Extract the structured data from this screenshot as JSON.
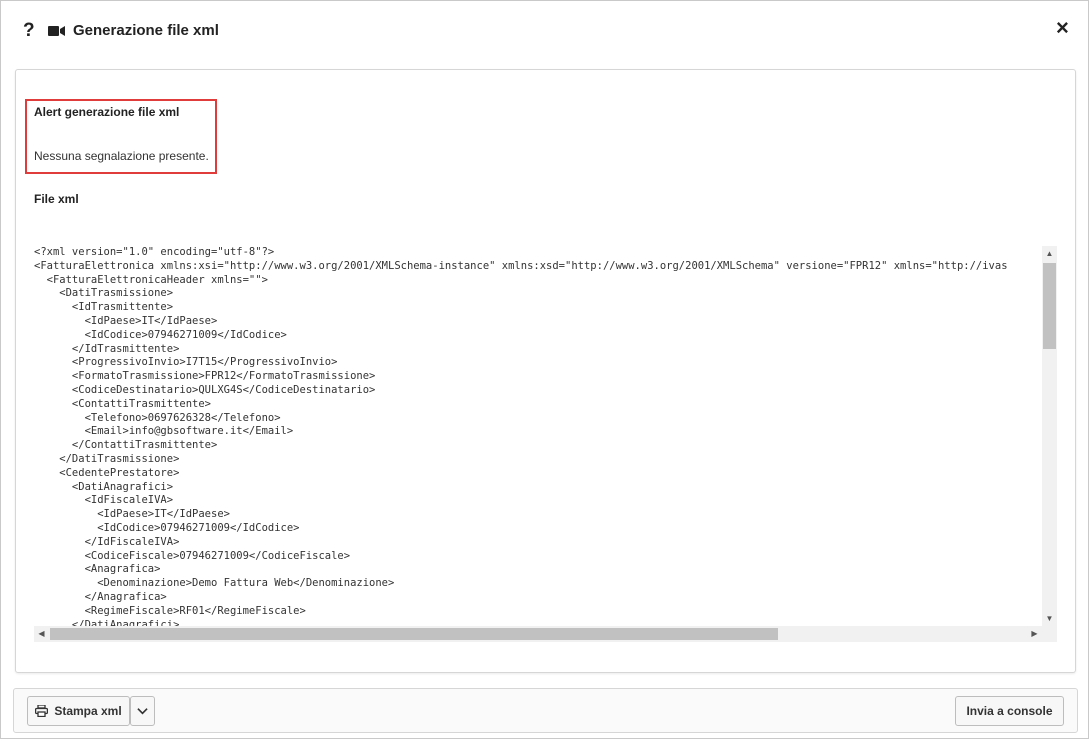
{
  "dialog": {
    "title": "Generazione file xml",
    "help_icon_glyph": "?",
    "close_icon_glyph": "×"
  },
  "alert": {
    "title": "Alert generazione file xml",
    "message": "Nessuna segnalazione presente.",
    "border_color": "#e03c3c"
  },
  "file": {
    "label": "File xml",
    "lines": [
      "<?xml version=\"1.0\" encoding=\"utf-8\"?>",
      "<FatturaElettronica xmlns:xsi=\"http://www.w3.org/2001/XMLSchema-instance\" xmlns:xsd=\"http://www.w3.org/2001/XMLSchema\" versione=\"FPR12\" xmlns=\"http://ivas",
      "  <FatturaElettronicaHeader xmlns=\"\">",
      "    <DatiTrasmissione>",
      "      <IdTrasmittente>",
      "        <IdPaese>IT</IdPaese>",
      "        <IdCodice>07946271009</IdCodice>",
      "      </IdTrasmittente>",
      "      <ProgressivoInvio>I7T15</ProgressivoInvio>",
      "      <FormatoTrasmissione>FPR12</FormatoTrasmissione>",
      "      <CodiceDestinatario>QULXG4S</CodiceDestinatario>",
      "      <ContattiTrasmittente>",
      "        <Telefono>0697626328</Telefono>",
      "        <Email>info@gbsoftware.it</Email>",
      "      </ContattiTrasmittente>",
      "    </DatiTrasmissione>",
      "    <CedentePrestatore>",
      "      <DatiAnagrafici>",
      "        <IdFiscaleIVA>",
      "          <IdPaese>IT</IdPaese>",
      "          <IdCodice>07946271009</IdCodice>",
      "        </IdFiscaleIVA>",
      "        <CodiceFiscale>07946271009</CodiceFiscale>",
      "        <Anagrafica>",
      "          <Denominazione>Demo Fattura Web</Denominazione>",
      "        </Anagrafica>",
      "        <RegimeFiscale>RF01</RegimeFiscale>",
      "      </DatiAnagrafici>"
    ]
  },
  "footer": {
    "print_label": "Stampa xml",
    "send_label": "Invia a console"
  },
  "icons": {
    "help": "help-icon",
    "video": "video-camera-icon",
    "close": "close-icon",
    "print": "printer-icon",
    "caret": "chevron-down-icon"
  }
}
